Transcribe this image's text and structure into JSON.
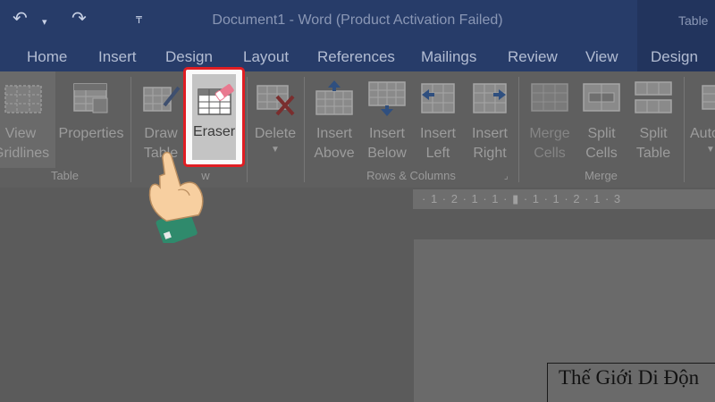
{
  "titlebar": {
    "title": "Document1 - Word (Product Activation Failed)",
    "context_title": "Table",
    "undo_icon": "undo-icon",
    "redo_icon": "redo-icon",
    "customize_icon": "customize-quick-access-icon"
  },
  "tabs": [
    "Home",
    "Insert",
    "Design",
    "Layout",
    "References",
    "Mailings",
    "Review",
    "View",
    "Design"
  ],
  "ribbon": {
    "groups": {
      "table": "Table",
      "draw": "w",
      "rows_columns": "Rows & Columns",
      "merge": "Merge"
    },
    "buttons": {
      "view_gridlines": [
        "View",
        "Gridlines"
      ],
      "properties": "Properties",
      "draw_table": [
        "Draw",
        "Table"
      ],
      "eraser": "Eraser",
      "delete": "Delete",
      "insert_above": [
        "Insert",
        "Above"
      ],
      "insert_below": [
        "Insert",
        "Below"
      ],
      "insert_left": [
        "Insert",
        "Left"
      ],
      "insert_right": [
        "Insert",
        "Right"
      ],
      "merge_cells": [
        "Merge",
        "Cells"
      ],
      "split_cells": [
        "Split",
        "Cells"
      ],
      "split_table": [
        "Split",
        "Table"
      ],
      "autofit": "Auto"
    }
  },
  "ruler": "· 1 · 2 · 1 · 1 · ▮ · 1 · 1 · 2 · 1 · 3",
  "document": {
    "cell_text": "Thế Giới Di Độn"
  },
  "colors": {
    "title_bar": "#273c69",
    "highlight": "#e01e23",
    "hand_skin": "#f7cfa0",
    "cuff": "#2f8a6c"
  }
}
